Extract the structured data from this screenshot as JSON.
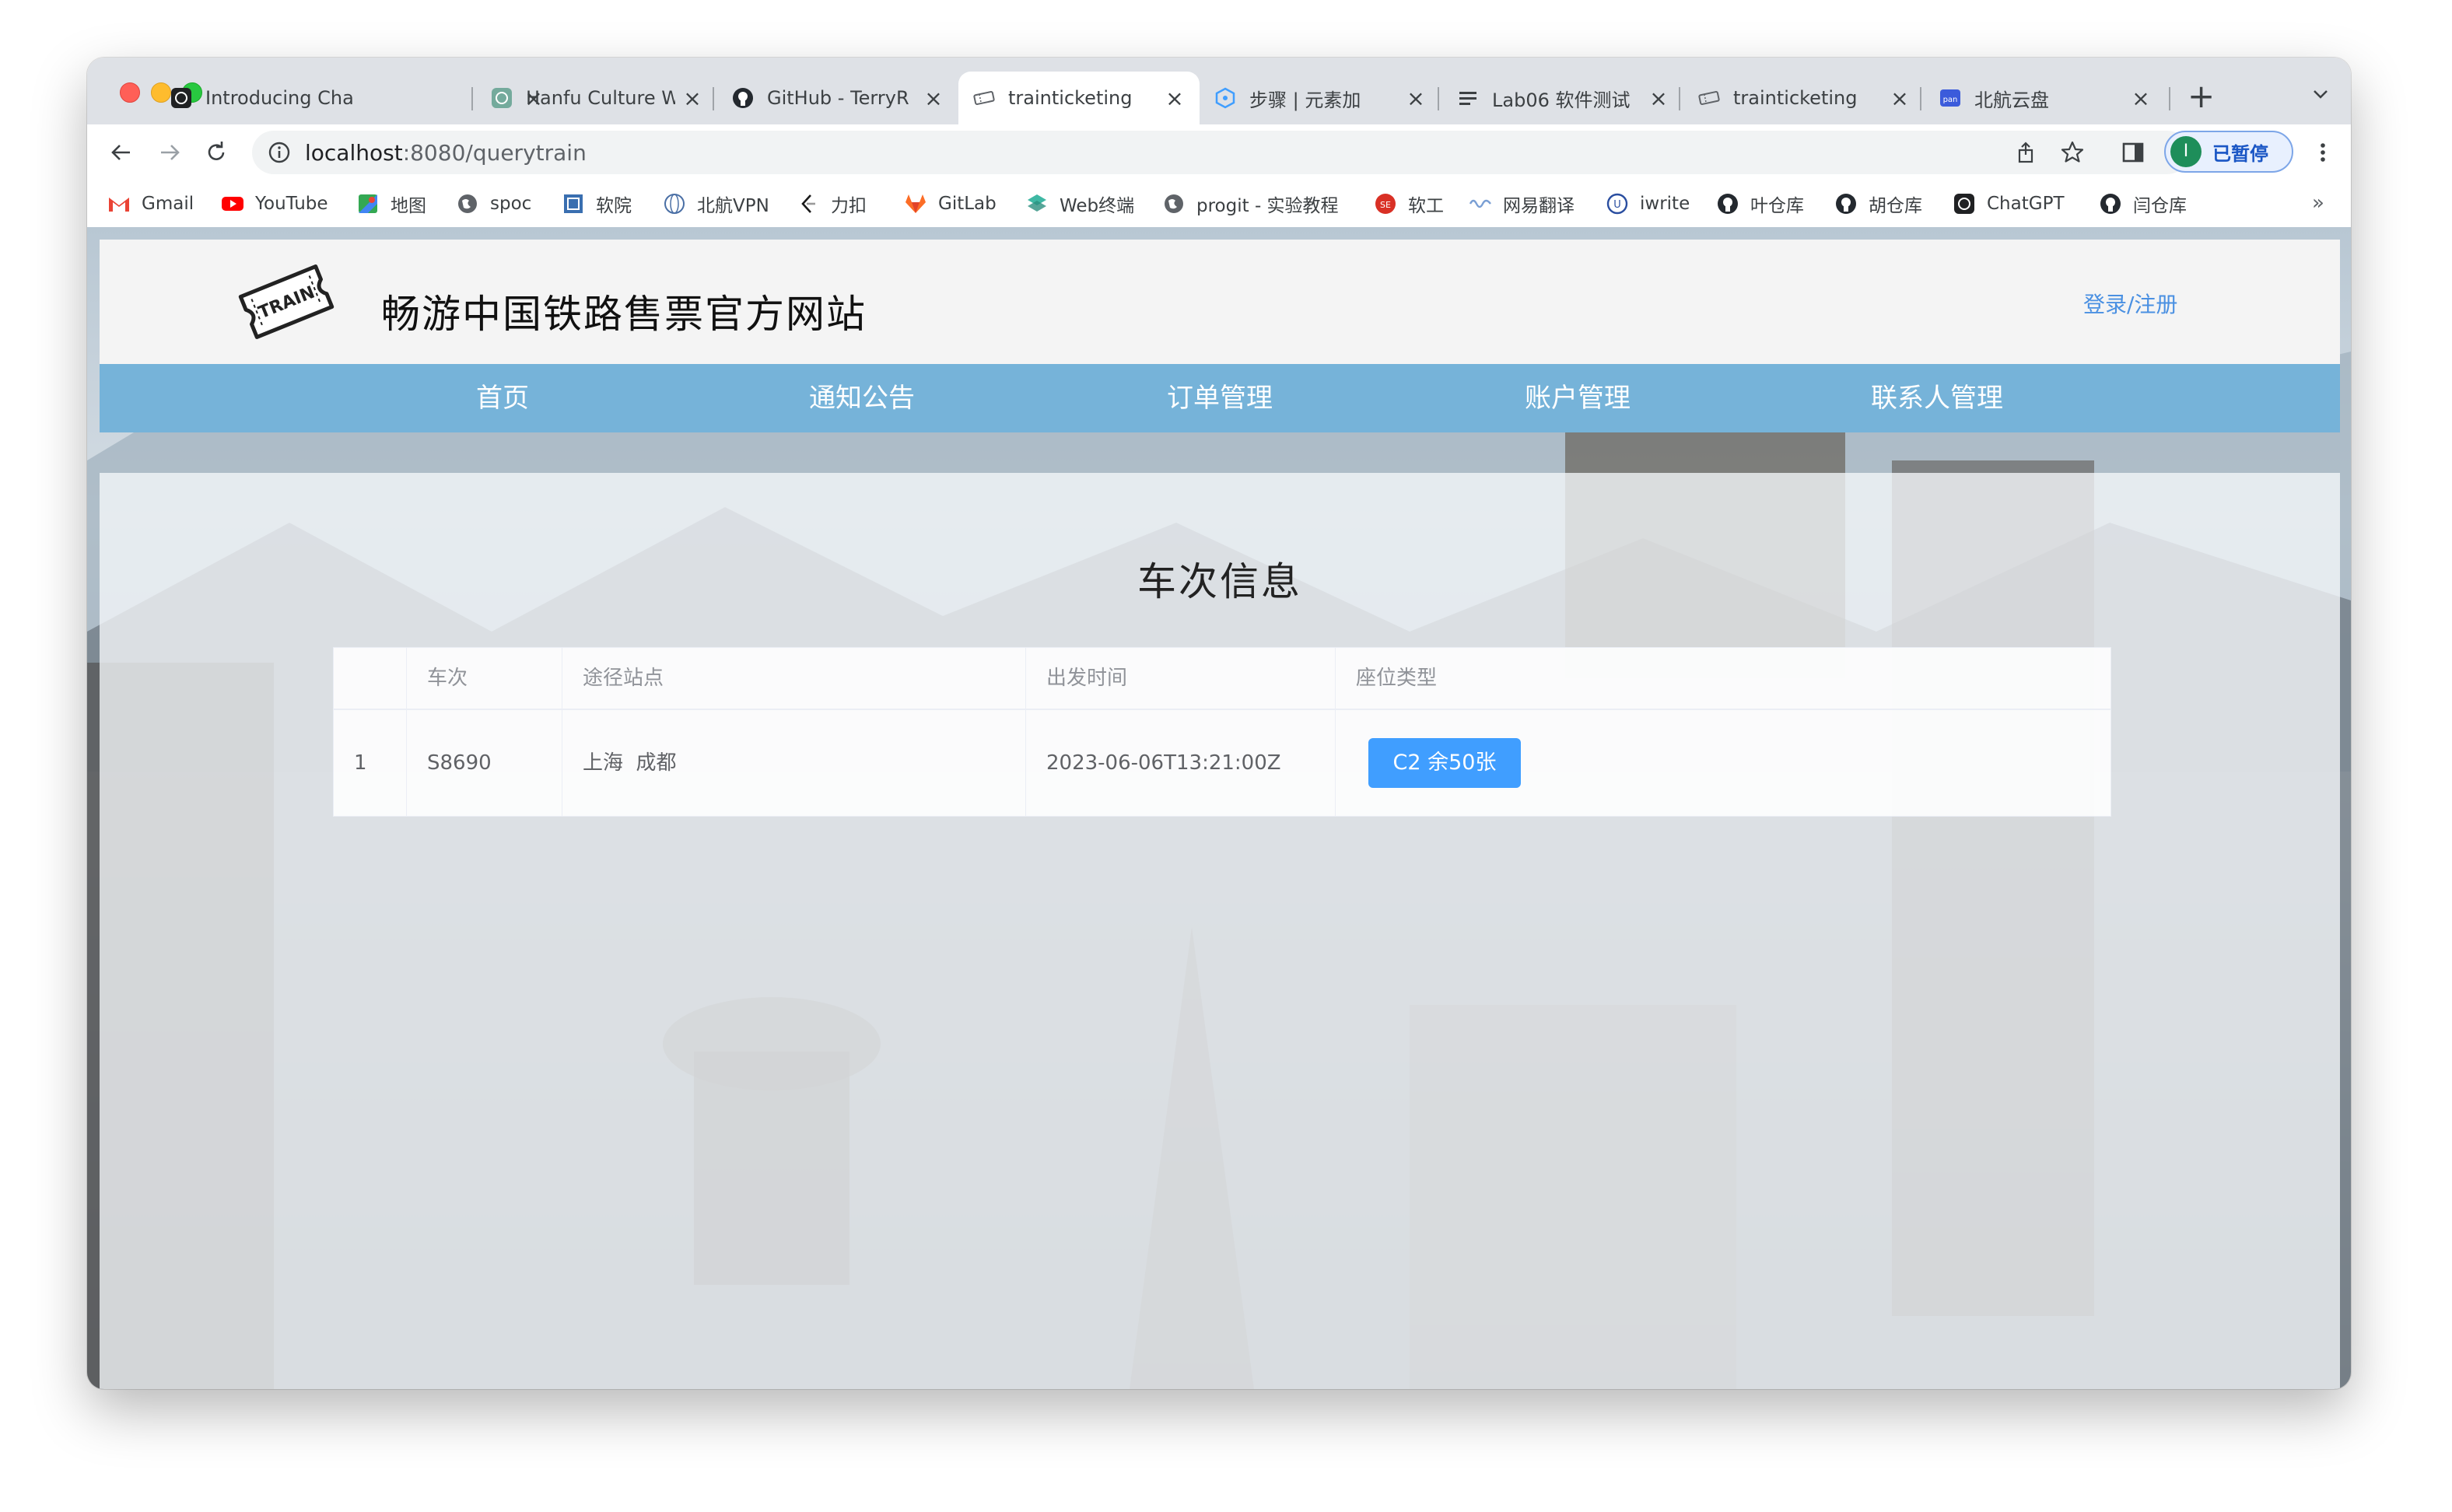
{
  "browser": {
    "tabs": [
      {
        "title": "Introducing Cha",
        "icon": "openai-icon"
      },
      {
        "title": "Hanfu Culture W",
        "icon": "chatgpt-icon"
      },
      {
        "title": "GitHub - TerryR",
        "icon": "github-icon"
      },
      {
        "title": "trainticketing",
        "icon": "ticket-icon",
        "active": true
      },
      {
        "title": "步骤 | 元素加",
        "icon": "element-icon"
      },
      {
        "title": "Lab06 软件测试",
        "icon": "doc-lines-icon"
      },
      {
        "title": "trainticketing",
        "icon": "ticket-icon"
      },
      {
        "title": "北航云盘",
        "icon": "cloud-disk-icon"
      }
    ],
    "url_host": "localhost",
    "url_rest": ":8080/querytrain",
    "profile": {
      "initial": "I",
      "label": "已暂停"
    },
    "bookmarks": [
      {
        "label": "Gmail",
        "icon": "gmail-icon"
      },
      {
        "label": "YouTube",
        "icon": "youtube-icon"
      },
      {
        "label": "地图",
        "icon": "maps-icon"
      },
      {
        "label": "spoc",
        "icon": "globe-icon"
      },
      {
        "label": "软院",
        "icon": "school-icon"
      },
      {
        "label": "北航VPN",
        "icon": "vpn-icon"
      },
      {
        "label": "力扣",
        "icon": "leetcode-icon"
      },
      {
        "label": "GitLab",
        "icon": "gitlab-icon"
      },
      {
        "label": "Web终端",
        "icon": "terminal-icon"
      },
      {
        "label": "progit - 实验教程",
        "icon": "globe-icon"
      },
      {
        "label": "软工",
        "icon": "se-icon"
      },
      {
        "label": "网易翻译",
        "icon": "translate-icon"
      },
      {
        "label": "iwrite",
        "icon": "iwrite-icon"
      },
      {
        "label": "叶仓库",
        "icon": "github-icon"
      },
      {
        "label": "胡仓库",
        "icon": "github-icon"
      },
      {
        "label": "ChatGPT",
        "icon": "openai-icon"
      },
      {
        "label": "闫仓库",
        "icon": "github-icon"
      }
    ],
    "bookmarks_more": "»"
  },
  "site": {
    "logo_text": "TRAIN",
    "title": "畅游中国铁路售票官方网站",
    "login": "登录/注册",
    "nav": [
      "首页",
      "通知公告",
      "订单管理",
      "账户管理",
      "联系人管理"
    ]
  },
  "content": {
    "section_title": "车次信息",
    "table": {
      "headers": [
        "",
        "车次",
        "途径站点",
        "出发时间",
        "座位类型"
      ],
      "rows": [
        {
          "index": "1",
          "train": "S8690",
          "stations": "上海  成都",
          "departure": "2023-06-06T13:21:00Z",
          "seat": "C2 余50张"
        }
      ]
    }
  },
  "colors": {
    "nav_bg": "#76b3d9",
    "primary_button": "#409eff",
    "link": "#4a90e2"
  }
}
